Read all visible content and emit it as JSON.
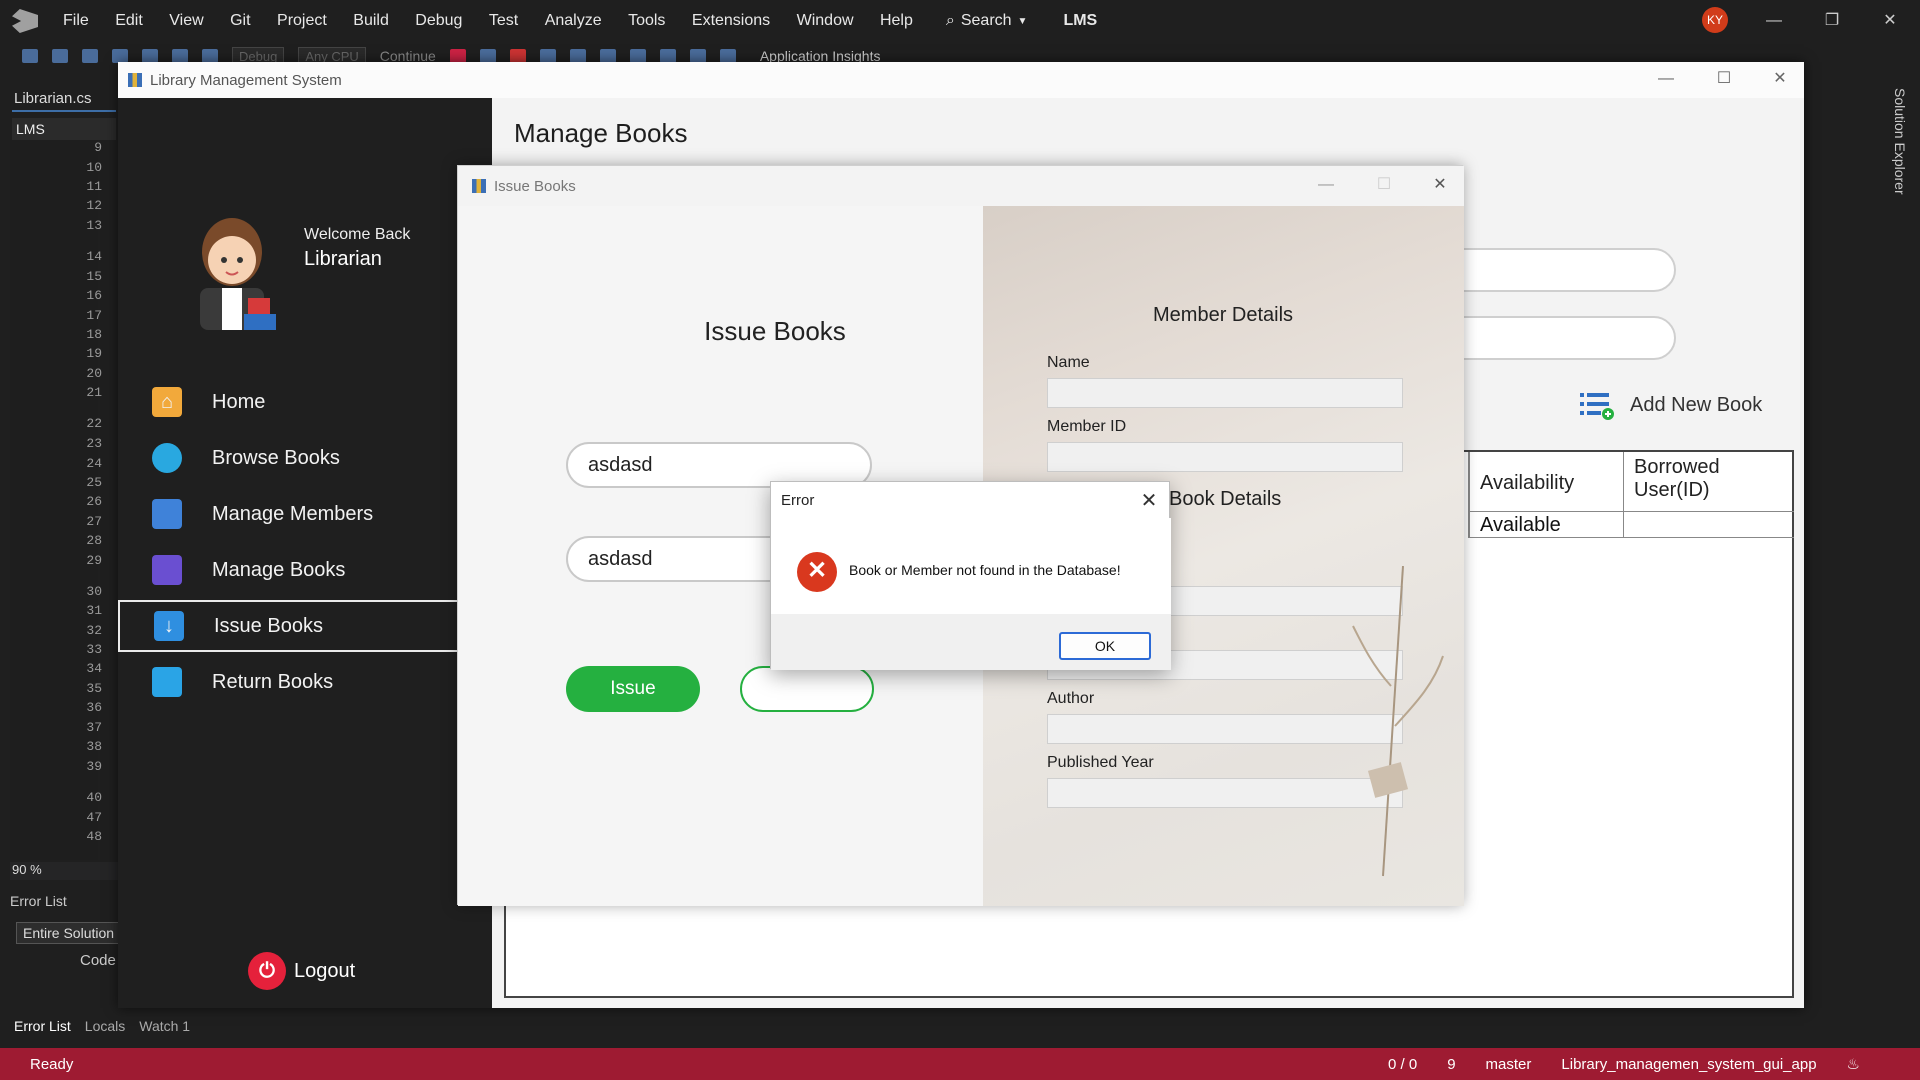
{
  "vs": {
    "menu": [
      "File",
      "Edit",
      "View",
      "Git",
      "Project",
      "Build",
      "Debug",
      "Test",
      "Analyze",
      "Tools",
      "Extensions",
      "Window",
      "Help"
    ],
    "search_label": "Search",
    "solution": "LMS",
    "avatar": "KY",
    "debug_config": "Debug",
    "platform": "Any CPU",
    "continue_label": "Continue",
    "app_insights": "Application Insights",
    "tab": "Librarian.cs",
    "project": "LMS",
    "line_numbers": [
      "9",
      "10",
      "11",
      "12",
      "13",
      "14",
      "15",
      "16",
      "17",
      "18",
      "19",
      "20",
      "21",
      "22",
      "23",
      "24",
      "25",
      "26",
      "27",
      "28",
      "29",
      "30",
      "31",
      "32",
      "33",
      "34",
      "35",
      "36",
      "37",
      "38",
      "39",
      "40",
      "47",
      "48"
    ],
    "zoom": "90 %",
    "error_list_header": "Error List",
    "scope": "Entire Solution",
    "code_col": "Code",
    "bottom_tabs": [
      "Error List",
      "Locals",
      "Watch 1"
    ],
    "solution_explorer": "Solution Explorer",
    "status": {
      "ready": "Ready",
      "changes": "0 / 0",
      "edits": "9",
      "branch": "master",
      "repo": "Library_managemen_system_gui_app"
    }
  },
  "lms": {
    "title": "Library Management System",
    "welcome": "Welcome Back",
    "role": "Librarian",
    "nav": [
      "Home",
      "Browse Books",
      "Manage Members",
      "Manage Books",
      "Issue Books",
      "Return Books"
    ],
    "active_nav": "Issue Books",
    "logout": "Logout",
    "page_title": "Manage Books",
    "add_new": "Add New Book",
    "table": {
      "col_availability": "Availability",
      "col_borrowed": "Borrowed User(ID)",
      "row_availability": "Available"
    }
  },
  "issue": {
    "title": "Issue Books",
    "heading": "Issue Books",
    "book_input": "asdasd",
    "member_input": "asdasd",
    "issue_button": "Issue",
    "member_details": "Member Details",
    "name_label": "Name",
    "member_id_label": "Member ID",
    "book_details": "Book Details",
    "author_label": "Author",
    "year_label": "Published Year"
  },
  "error": {
    "title": "Error",
    "message": "Book or Member not found in the Database!",
    "ok": "OK"
  }
}
